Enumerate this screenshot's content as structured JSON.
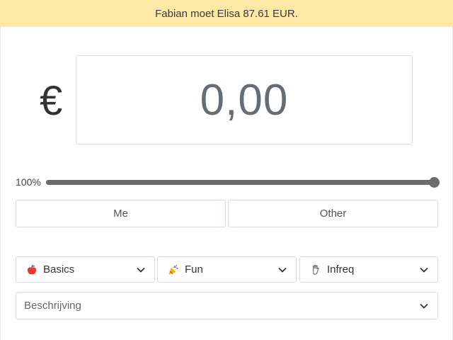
{
  "banner": {
    "text": "Fabian moet Elisa 87.61 EUR."
  },
  "amount": {
    "currency_symbol": "€",
    "value": "0,00"
  },
  "split": {
    "percent_label": "100%",
    "percent_value": 100
  },
  "segment": {
    "me_label": "Me",
    "other_label": "Other"
  },
  "categories": [
    {
      "label": "Basics",
      "icon": "apple-icon"
    },
    {
      "label": "Fun",
      "icon": "party-popper-icon"
    },
    {
      "label": "Infreq",
      "icon": "hand-icon"
    }
  ],
  "description": {
    "placeholder": "Beschrijving"
  },
  "colors": {
    "banner_bg": "#fde8a6",
    "slider": "#6c6c6c",
    "apple": "#e53935"
  }
}
